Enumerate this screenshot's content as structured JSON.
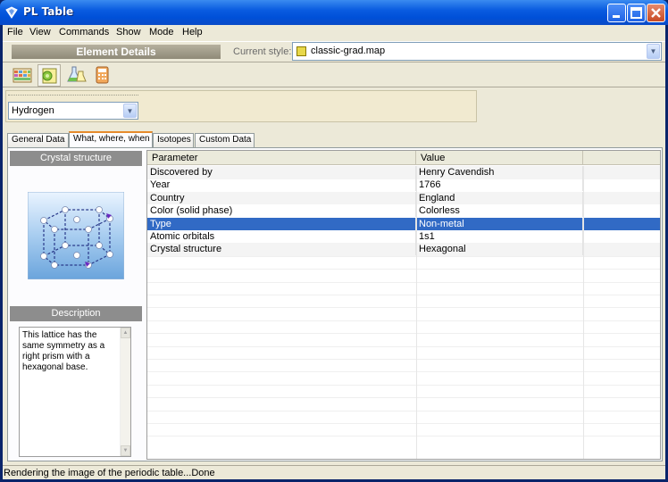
{
  "window": {
    "title": "PL Table"
  },
  "menu": [
    "File",
    "View",
    "Commands",
    "Show",
    "Mode",
    "Help"
  ],
  "panel_title": "Element Details",
  "style": {
    "label": "Current style:",
    "value": "classic-grad.map"
  },
  "element_select": {
    "value": "Hydrogen"
  },
  "tabs": [
    "General Data",
    "What, where, when",
    "Isotopes",
    "Custom Data"
  ],
  "active_tab": 1,
  "left_panel": {
    "crystal_heading": "Crystal structure",
    "description_heading": "Description",
    "description_text": "This lattice has the same symmetry as a right prism with a hexagonal base."
  },
  "table": {
    "columns": [
      "Parameter",
      "Value"
    ],
    "rows": [
      [
        "Discovered by",
        "Henry Cavendish"
      ],
      [
        "Year",
        "1766"
      ],
      [
        "Country",
        "England"
      ],
      [
        "Color (solid phase)",
        "Colorless"
      ],
      [
        "Type",
        "Non-metal"
      ],
      [
        "Atomic orbitals",
        "1s1"
      ],
      [
        "Crystal structure",
        "Hexagonal"
      ]
    ],
    "selected_row": 4
  },
  "status_text": "Rendering the image of the periodic table...Done",
  "colors": {
    "selection": "#316ac5",
    "titlebar": "#0a5ce0",
    "tab_accent": "#e68b2c"
  }
}
